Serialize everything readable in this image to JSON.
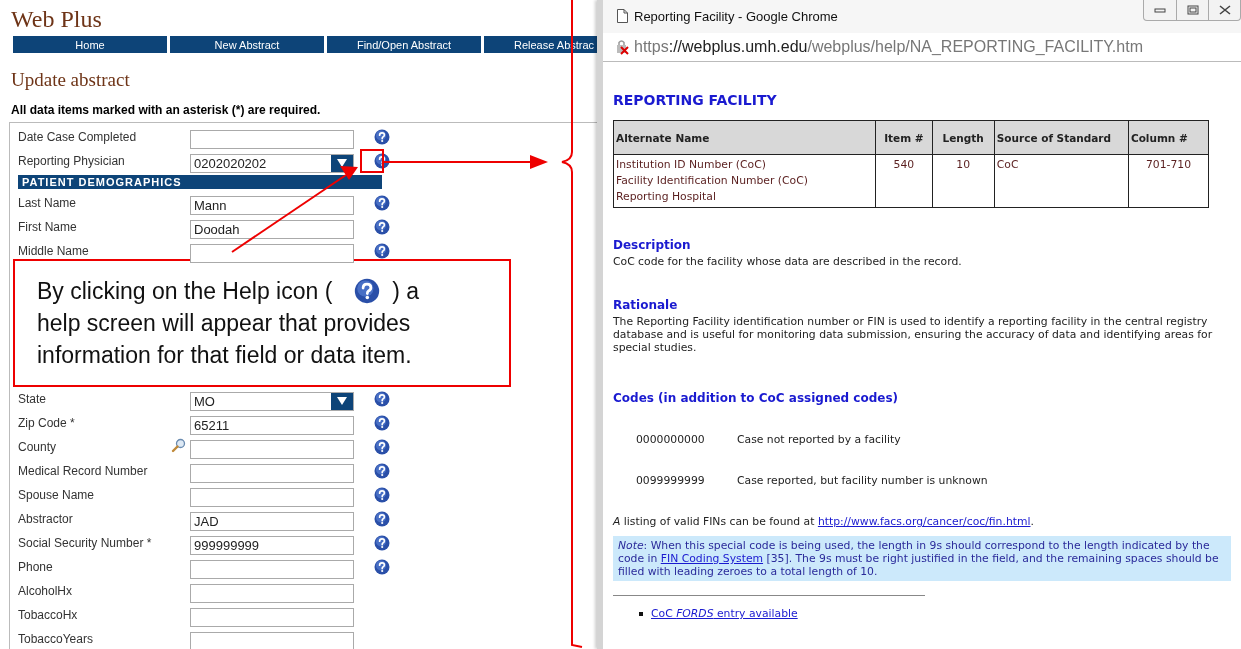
{
  "app": {
    "title": "Web Plus"
  },
  "nav": [
    {
      "label": "Home"
    },
    {
      "label": "New Abstract"
    },
    {
      "label": "Find/Open Abstract"
    },
    {
      "label": "Release Abstrac"
    }
  ],
  "page_title": "Update abstract",
  "required_note": "All data items marked with an asterisk (*) are required.",
  "form": {
    "upper_rows": [
      {
        "kind": "field",
        "label": "Date Case Completed",
        "help": true
      },
      {
        "kind": "select",
        "label": "Reporting Physician",
        "value": "0202020202",
        "help": true,
        "highlighted": true
      },
      {
        "kind": "section",
        "label": "PATIENT DEMOGRAPHICS"
      },
      {
        "kind": "field",
        "label": "Last Name",
        "value": "Mann",
        "help": true
      },
      {
        "kind": "field",
        "label": "First Name",
        "value": "Doodah",
        "help": true
      },
      {
        "kind": "field",
        "label": "Middle Name",
        "help": true
      }
    ],
    "lower_rows": [
      {
        "kind": "select",
        "label": "State",
        "value": "MO",
        "help": true
      },
      {
        "kind": "field",
        "label": "Zip Code *",
        "value": "65211",
        "help": true
      },
      {
        "kind": "lookup",
        "label": "County",
        "help": true
      },
      {
        "kind": "field",
        "label": "Medical Record Number",
        "help": true
      },
      {
        "kind": "field",
        "label": "Spouse Name",
        "help": true
      },
      {
        "kind": "field",
        "label": "Abstractor",
        "value": "JAD",
        "help": true
      },
      {
        "kind": "field",
        "label": "Social Security Number *",
        "value": "999999999",
        "help": true
      },
      {
        "kind": "field",
        "label": "Phone",
        "help": true
      },
      {
        "kind": "field",
        "label": "AlcoholHx",
        "help": false
      },
      {
        "kind": "field",
        "label": "TobaccoHx",
        "help": false
      },
      {
        "kind": "field",
        "label": "TobaccoYears",
        "help": false
      }
    ]
  },
  "callout": {
    "text_before": "By clicking on the Help icon (",
    "text_middle": ") a",
    "text_after": "help screen will appear that provides information for that field or data item."
  },
  "popup": {
    "title": "Reporting Facility - Google Chrome",
    "url": {
      "scheme": "https",
      "rest_host": "://webplus.umh.edu",
      "path": "/webplus/help/NA_REPORTING_FACILITY.htm"
    },
    "heading": "REPORTING FACILITY",
    "table": {
      "columns": [
        "Alternate Name",
        "Item #",
        "Length",
        "Source of Standard",
        "Column #"
      ],
      "rows": [
        [
          "Institution ID Number (CoC)\nFacility Identification Number (CoC)\nReporting Hospital",
          "540",
          "10",
          "CoC",
          "701-710"
        ]
      ]
    },
    "sections": [
      {
        "heading": "Description",
        "text": "CoC code for the facility whose data are described in the record."
      },
      {
        "heading": "Rationale",
        "text": "The Reporting Facility identification number or FIN is used to identify a reporting facility in the central registry database and is useful for monitoring data submission, ensuring the accuracy of data and identifying areas for special studies."
      }
    ],
    "codes_heading": "Codes (in addition to CoC assigned codes)",
    "codes": [
      {
        "code": "0000000000",
        "meaning": "Case not reported by a facility"
      },
      {
        "code": "0099999999",
        "meaning": "Case reported, but facility number is unknown"
      }
    ],
    "listing": {
      "before": "*A* listing of valid FINs can be found at ",
      "link": "http://www.facs.org/cancer/coc/fin.html",
      "after": "."
    },
    "note": {
      "before": "*Note*:   When this special code is being used, the length in 9s should correspond to the length indicated by the code in ",
      "link": "FIN Coding System",
      "after": " [35].  The 9s must be right justified in the field, and the remaining spaces should be filled with leading zeroes to a total length of 10."
    },
    "links": [
      {
        "label": "CoC *FORDS* entry available"
      }
    ]
  }
}
